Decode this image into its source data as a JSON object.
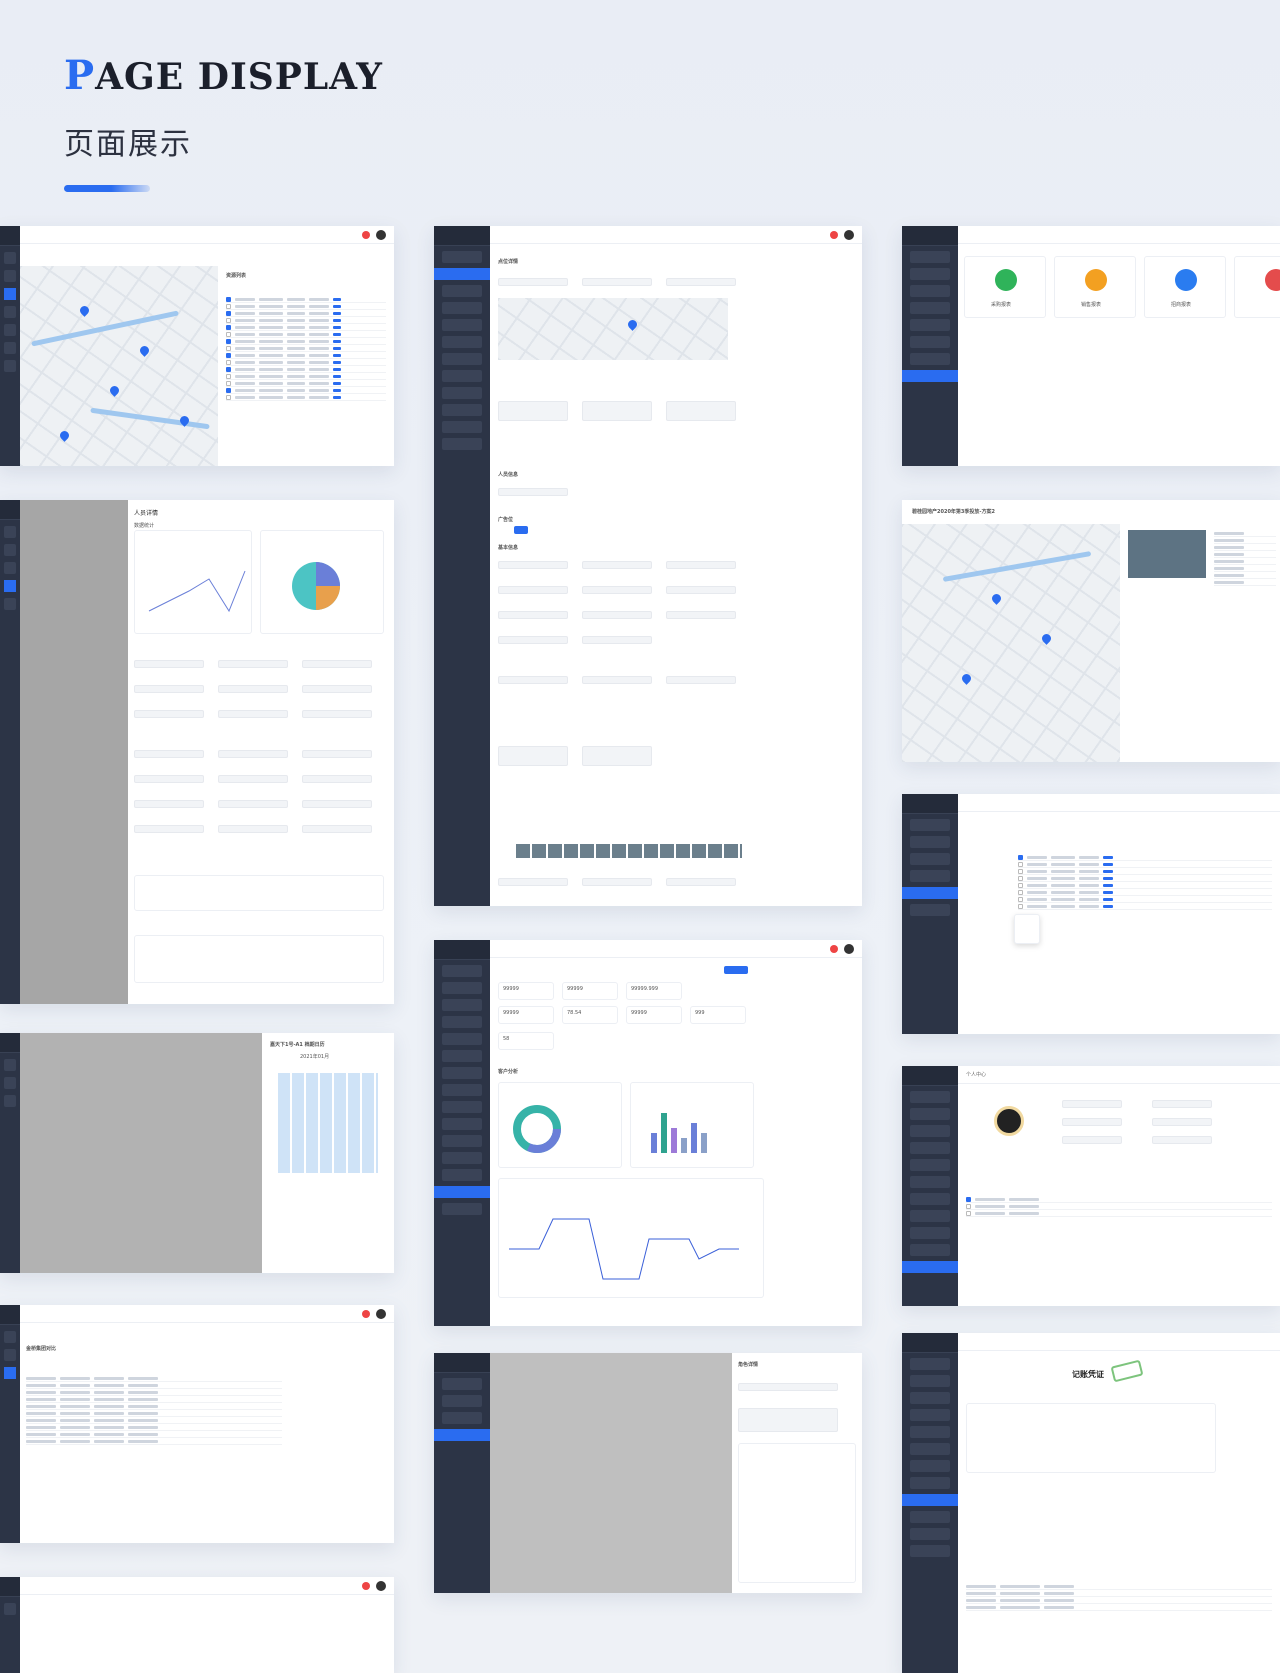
{
  "header": {
    "title_first": "P",
    "title_rest": "AGE DISPLAY",
    "subtitle": "页面展示"
  },
  "shots": {
    "map_list": {
      "list_title": "资源列表"
    },
    "detail_form": {
      "form_title": "点位详情",
      "section_people": "人员信息",
      "section_ad": "广告位",
      "section_basic": "基本信息"
    },
    "report_cards": {
      "cards": [
        "采购报表",
        "销售报表",
        "招商报表"
      ]
    },
    "person_detail": {
      "title": "人员详情",
      "stats": "数据统计"
    },
    "map_detail": {
      "title": "碧桂园地产2020年第3季投放-方案2"
    },
    "analysis": {
      "values": [
        "99999",
        "99999",
        "99999.999",
        "99999",
        "78.54",
        "99999",
        "999",
        "58"
      ],
      "section": "客户分析"
    },
    "calendar": {
      "title": "2021年01月",
      "side_title": "嘉天下1号-A1 档期日历"
    },
    "profile": {
      "title": "个人中心"
    },
    "voucher": {
      "title": "记账凭证"
    },
    "compare": {
      "title": "金桥集团对比"
    },
    "role": {
      "title": "角色详情"
    }
  }
}
